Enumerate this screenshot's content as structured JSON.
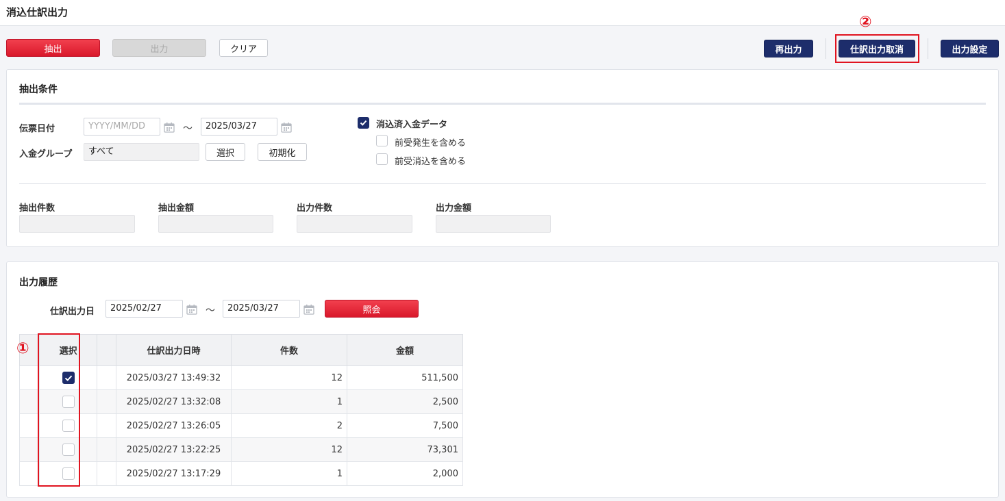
{
  "page": {
    "title": "消込仕訳出力"
  },
  "toolbar": {
    "extract_label": "抽出",
    "output_label": "出力",
    "clear_label": "クリア",
    "reoutput_label": "再出力",
    "cancel_output_label": "仕訳出力取消",
    "output_settings_label": "出力設定"
  },
  "conditions": {
    "title": "抽出条件",
    "slip_date_label": "伝票日付",
    "date_from_placeholder": "YYYY/MM/DD",
    "date_from_value": "",
    "date_to_value": "2025/03/27",
    "tilde": "～",
    "group_label": "入金グループ",
    "group_value": "すべて",
    "select_label": "選択",
    "reset_label": "初期化",
    "chk_reconciled_label": "消込済入金データ",
    "chk_reconciled_checked": true,
    "chk_advance_occ_label": "前受発生を含める",
    "chk_advance_occ_checked": false,
    "chk_advance_rec_label": "前受消込を含める",
    "chk_advance_rec_checked": false,
    "summary": {
      "extract_count_label": "抽出件数",
      "extract_amount_label": "抽出金額",
      "output_count_label": "出力件数",
      "output_amount_label": "出力金額",
      "extract_count": "",
      "extract_amount": "",
      "output_count": "",
      "output_amount": ""
    }
  },
  "history": {
    "title": "出力履歴",
    "date_label": "仕訳出力日",
    "date_from": "2025/02/27",
    "date_to": "2025/03/27",
    "tilde": "～",
    "search_label": "照会",
    "columns": [
      "選択",
      "仕訳出力日時",
      "件数",
      "金額"
    ],
    "rows": [
      {
        "checked": true,
        "datetime": "2025/03/27 13:49:32",
        "count": "12",
        "amount": "511,500"
      },
      {
        "checked": false,
        "datetime": "2025/02/27 13:32:08",
        "count": "1",
        "amount": "2,500"
      },
      {
        "checked": false,
        "datetime": "2025/02/27 13:26:05",
        "count": "2",
        "amount": "7,500"
      },
      {
        "checked": false,
        "datetime": "2025/02/27 13:22:25",
        "count": "12",
        "amount": "73,301"
      },
      {
        "checked": false,
        "datetime": "2025/02/27 13:17:29",
        "count": "1",
        "amount": "2,000"
      }
    ]
  },
  "annotations": {
    "marker1": "①",
    "marker2": "②"
  },
  "colors": {
    "accent_red": "#e0131f",
    "navy": "#1d2d6b"
  }
}
